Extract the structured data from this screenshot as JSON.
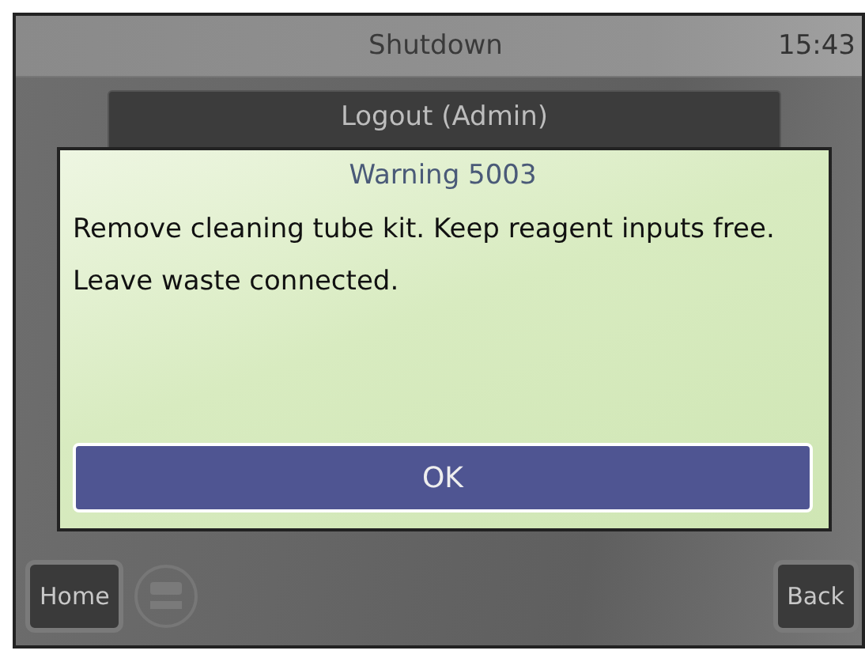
{
  "header": {
    "title": "Shutdown",
    "time": "15:43"
  },
  "menu_button": {
    "label": "Logout (Admin)"
  },
  "dialog": {
    "title": "Warning 5003",
    "message": "Remove cleaning tube kit. Keep reagent inputs free. Leave waste connected.",
    "button": "OK"
  },
  "footer": {
    "buttons": [
      {
        "label": "Home",
        "kind": "left"
      },
      {
        "label": "Back",
        "kind": "right"
      }
    ]
  }
}
